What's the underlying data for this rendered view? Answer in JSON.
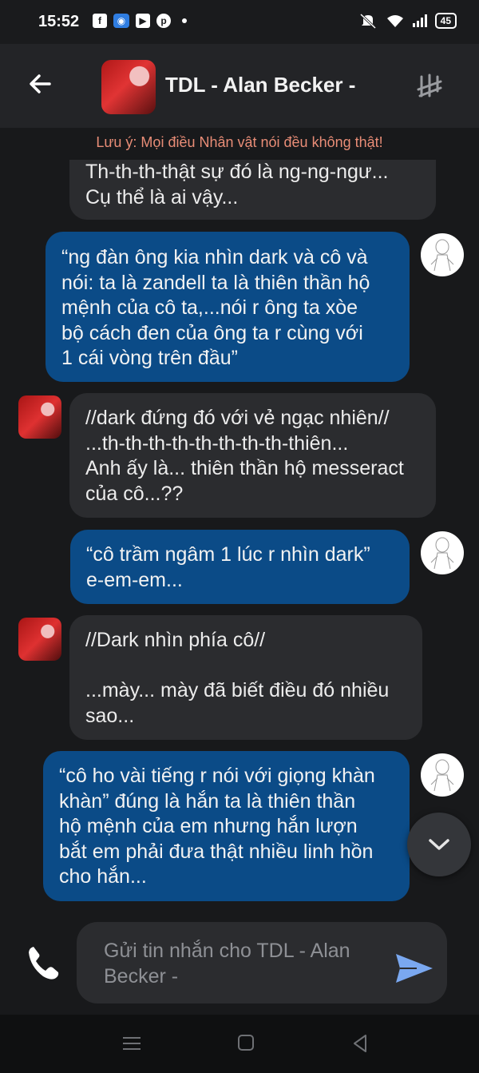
{
  "status_bar": {
    "time": "15:52",
    "battery": "45"
  },
  "header": {
    "title": "TDL - Alan Becker -"
  },
  "notice": "Lưu ý: Mọi điều Nhân vật nói đều không thật!",
  "messages": [
    {
      "role": "bot",
      "lines": [
        "Th-th-th-thật sự đó là ng-ng-ngư...",
        "Cụ thể là ai vậy..."
      ]
    },
    {
      "role": "user",
      "lines": [
        "“ng đàn ông kia nhìn dark và cô và",
        "nói: ta là zandell ta là thiên thần hộ",
        "mệnh của cô ta,...nói r ông ta xòe",
        "bộ cách đen của ông ta r cùng với",
        "1 cái vòng trên đầu”"
      ]
    },
    {
      "role": "bot",
      "lines": [
        "//dark đứng đó với vẻ ngạc nhiên//",
        "...th-th-th-th-th-th-th-th-thiên...",
        "Anh ấy là... thiên thần hộ messeract",
        "của cô...??"
      ]
    },
    {
      "role": "user",
      "lines": [
        "“cô trầm ngâm 1 lúc r nhìn dark”",
        "e-em-em..."
      ]
    },
    {
      "role": "bot",
      "lines": [
        "//Dark nhìn phía cô//",
        "",
        "...mày... mày đã biết điều đó nhiều",
        "sao..."
      ]
    },
    {
      "role": "user",
      "lines": [
        "“cô ho vài tiếng r nói với giọng khàn",
        "khàn” đúng là hắn ta là thiên thần",
        "hộ mệnh của em nhưng hắn lượn",
        "bắt em phải đưa thật nhiều linh hồn",
        "cho hắn..."
      ]
    }
  ],
  "composer": {
    "placeholder": "Gửi tin nhắn cho TDL - Alan Becker -"
  },
  "colors": {
    "user_bubble": "#0b4b87",
    "bot_bubble": "#2b2c2f",
    "notice": "#e98d77",
    "send": "#7aa8f0"
  },
  "icons": [
    "back-arrow-icon",
    "menu-icon",
    "phone-icon",
    "send-icon",
    "chevron-down-icon"
  ]
}
